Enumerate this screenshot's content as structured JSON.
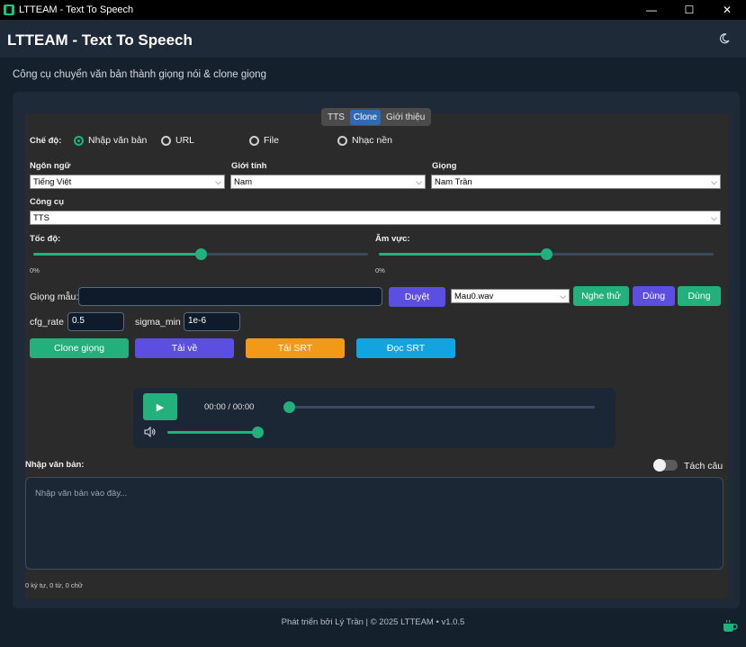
{
  "window": {
    "title": "LTTEAM - Text To Speech",
    "minimize": "—",
    "maximize": "☐",
    "close": "✕"
  },
  "header": {
    "title": "LTTEAM - Text To Speech",
    "theme_icon": "moon-icon"
  },
  "subtitle": "Công cụ chuyển văn bản thành giọng nói & clone giọng",
  "tabs": [
    {
      "label": "TTS"
    },
    {
      "label": "Clone"
    },
    {
      "label": "Giới thiệu"
    }
  ],
  "active_tab": "Clone",
  "mode": {
    "label": "Chế độ:",
    "options": [
      {
        "label": "Nhập văn bản"
      },
      {
        "label": "URL"
      },
      {
        "label": "File"
      },
      {
        "label": "Nhạc nền"
      }
    ],
    "selected": "Nhập văn bản"
  },
  "fields": {
    "language": {
      "label": "Ngôn ngữ",
      "value": "Tiếng Việt"
    },
    "gender": {
      "label": "Giới tính",
      "value": "Nam"
    },
    "voice": {
      "label": "Giọng",
      "value": "Nam Trần"
    },
    "tool": {
      "label": "Công cụ",
      "value": "TTS"
    }
  },
  "speed": {
    "label": "Tốc độ:",
    "value_text": "0%",
    "level": 0.5
  },
  "volume": {
    "label": "Âm vực:",
    "value_text": "0%",
    "level": 0.5
  },
  "sample": {
    "label": "Giọng mẫu:",
    "value": "",
    "browse": "Duyệt",
    "file": "Mau0.wav",
    "listen": "Nghe thử",
    "use1": "Dùng",
    "use2": "Dùng"
  },
  "params": {
    "cfg_label": "cfg_rate",
    "cfg_value": "0.5",
    "sigma_label": "sigma_min",
    "sigma_value": "1e-6"
  },
  "actions": {
    "clone": "Clone giọng",
    "download": "Tải về",
    "srt_download": "Tải SRT",
    "srt_read": "Đọc SRT"
  },
  "player": {
    "time": "00:00 / 00:00",
    "progress": 0.0,
    "volume": 1.0
  },
  "input": {
    "label": "Nhập văn bản:",
    "split_label": "Tách câu",
    "split_on": false,
    "placeholder": "Nhập văn bản vào đây...",
    "stats": "0 ký tự, 0 từ, 0 chữ"
  },
  "footer": "Phát triển bởi Lý Trần | © 2025 LTTEAM • v1.0.5",
  "colors": {
    "accent": "#22b07d",
    "purple": "#5b4ee0",
    "orange": "#f29a17",
    "sky": "#12a3e1",
    "tab_active": "#2e6bb3"
  }
}
